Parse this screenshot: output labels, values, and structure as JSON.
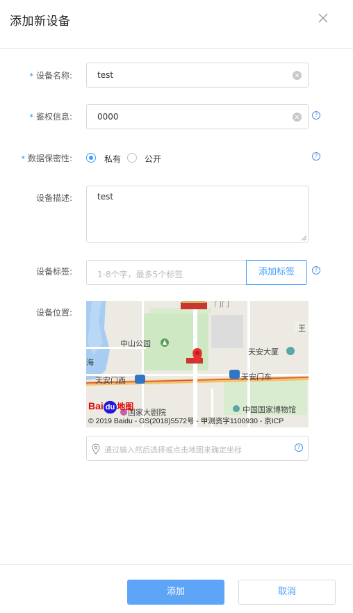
{
  "dialog": {
    "title": "添加新设备"
  },
  "form": {
    "required_mark": "*",
    "help_glyph": "?",
    "name": {
      "label": "设备名称:",
      "value": "test"
    },
    "auth": {
      "label": "鉴权信息:",
      "value": "0000"
    },
    "privacy": {
      "label": "数据保密性:",
      "options": [
        "私有",
        "公开"
      ],
      "selected": "私有"
    },
    "description": {
      "label": "设备描述:",
      "value": "test"
    },
    "tags": {
      "label": "设备标签:",
      "placeholder": "1-8个字，最多5个标签",
      "add_button": "添加标签"
    },
    "location": {
      "label": "设备位置:",
      "placeholder": "通过输入然后选择或点击地图来确定坐标"
    }
  },
  "map": {
    "labels": {
      "park": "中山公园",
      "building": "天安大厦",
      "west": "天安门西",
      "east": "天安门东",
      "theatre": "国家大剧院",
      "museum": "中国国家博物馆",
      "hai": "海",
      "wang": "王",
      "gate_text": "门门"
    },
    "logo": {
      "bai": "Bai",
      "du": "du",
      "ditu": "地图"
    },
    "copyright": "© 2019 Baidu - GS(2018)5572号 - 甲测资字1100930 - 京ICP"
  },
  "footer": {
    "confirm": "添加",
    "cancel": "取消"
  },
  "colors": {
    "accent": "#409eff",
    "primary_button": "#5ea4f7",
    "marker": "#e8312f"
  }
}
